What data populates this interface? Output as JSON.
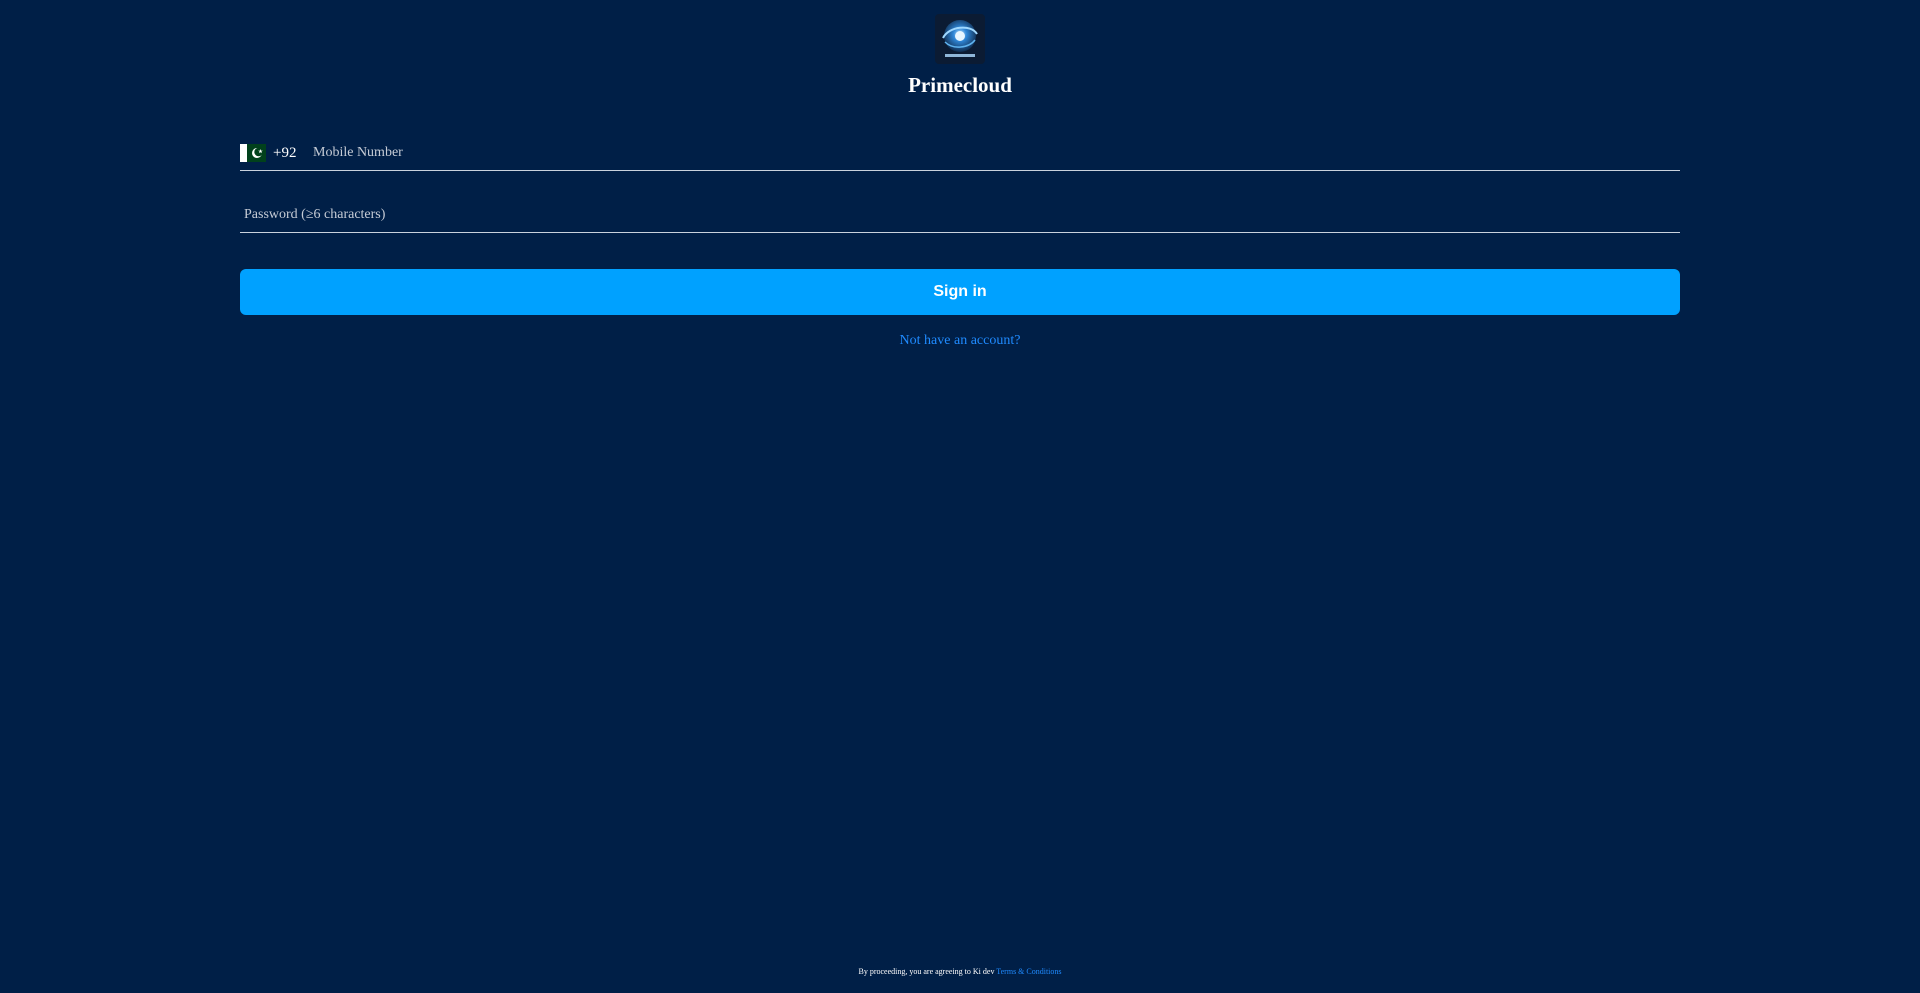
{
  "app": {
    "title": "Primecloud",
    "logo_icon": "primecloud-logo-icon"
  },
  "login": {
    "phone": {
      "flag_icon": "pakistan-flag-icon",
      "country_code": "+92",
      "value": "",
      "placeholder": "Mobile Number"
    },
    "password": {
      "value": "",
      "placeholder": "Password (≥6 characters)"
    },
    "signin_label": "Sign in",
    "register_link": "Not have an account?"
  },
  "footer": {
    "text": "By proceeding, you are agreeing to Ki dev",
    "terms_link": "Terms & Conditions"
  },
  "colors": {
    "background": "#001f47",
    "accent": "#00a1ff",
    "link": "#1f8bff"
  }
}
